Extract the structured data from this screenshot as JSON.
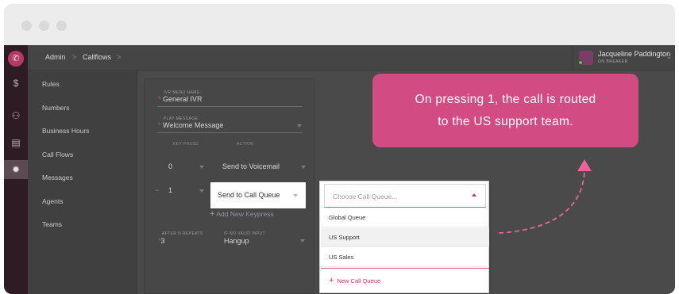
{
  "window": {
    "controls": [
      "close",
      "minimize",
      "zoom"
    ]
  },
  "rail": {
    "logo_icon": "phone-icon",
    "icons": [
      "dollar-icon",
      "users-icon",
      "id-card-icon",
      "gear-icon"
    ]
  },
  "breadcrumb": {
    "items": [
      "Admin",
      "Callflows"
    ],
    "separator": ">"
  },
  "user": {
    "name": "Jacqueline Paddington",
    "status": "ON BREAKER"
  },
  "subnav": {
    "items": [
      "Rules",
      "Numbers",
      "Business Hours",
      "Call Flows",
      "Messages",
      "Agents",
      "Teams"
    ]
  },
  "ivr": {
    "menu_name_label": "IVR MENU NAME",
    "menu_name_value": "General IVR",
    "play_message_label": "PLAY MESSAGE",
    "play_message_value": "Welcome Message",
    "col_keypress": "KEY PRESS",
    "col_action": "ACTION",
    "rows": [
      {
        "key": "0",
        "action": "Send to Voicemail"
      },
      {
        "key": "1",
        "action": "Send to Call Queue"
      }
    ],
    "add_keypress": "Add New Keypress",
    "after_repeats_label": "AFTER N REPEATS",
    "after_repeats_value": "3",
    "no_input_label": "IF NO VALID INPUT",
    "no_input_value": "Hangup",
    "required_mark": "*"
  },
  "queue_dropdown": {
    "placeholder": "Choose Call Queue...",
    "options": [
      "Global Queue",
      "US Support",
      "US Sales"
    ],
    "highlighted": "US Support",
    "new_label": "New Call Queue"
  },
  "callout": {
    "line1": "On pressing 1, the call is routed",
    "line2": "to the US support team."
  },
  "colors": {
    "brand_pink": "#d24c83",
    "accent_red": "#c93664"
  }
}
